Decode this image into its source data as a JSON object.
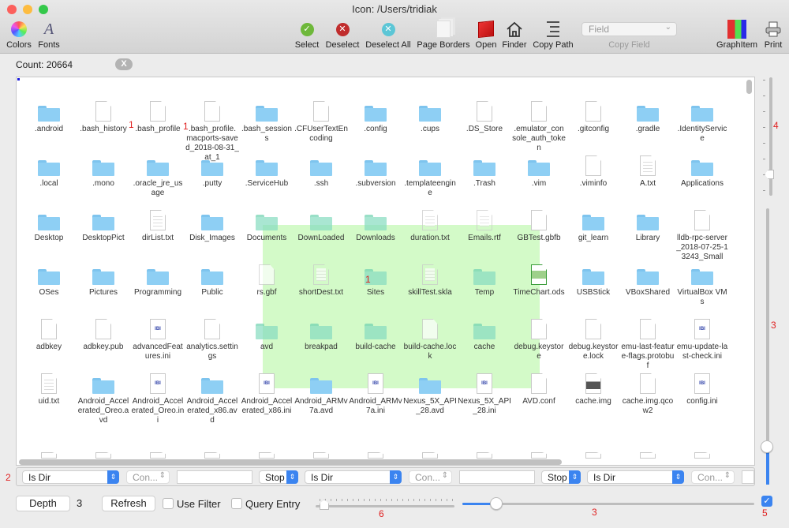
{
  "window": {
    "title": "Icon: /Users/tridiak"
  },
  "toolbar": {
    "colors": "Colors",
    "fonts": "Fonts",
    "select": "Select",
    "deselect": "Deselect",
    "deselect_all": "Deselect All",
    "page_borders": "Page Borders",
    "open": "Open",
    "finder": "Finder",
    "copy_path": "Copy Path",
    "field_placeholder": "Field",
    "copy_field": "Copy Field",
    "graph_item": "GraphItem",
    "print": "Print"
  },
  "status": {
    "count": "Count: 20664",
    "clear": "X"
  },
  "grid": {
    "selection_badge": "1",
    "badges": [
      "1",
      "1"
    ],
    "rows": [
      [
        {
          "name": ".android",
          "type": "folder"
        },
        {
          "name": ".bash_history",
          "type": "doc"
        },
        {
          "name": ".bash_profile",
          "type": "doc"
        },
        {
          "name": ".bash_profile.macports-saved_2018-08-31_at_1",
          "type": "doc"
        },
        {
          "name": ".bash_sessions",
          "type": "folder"
        },
        {
          "name": ".CFUserTextEncoding",
          "type": "doc"
        },
        {
          "name": ".config",
          "type": "folder"
        },
        {
          "name": ".cups",
          "type": "folder"
        },
        {
          "name": ".DS_Store",
          "type": "doc"
        },
        {
          "name": ".emulator_console_auth_token",
          "type": "doc"
        },
        {
          "name": ".gitconfig",
          "type": "doc"
        },
        {
          "name": ".gradle",
          "type": "folder"
        },
        {
          "name": ".IdentityService",
          "type": "folder"
        }
      ],
      [
        {
          "name": ".local",
          "type": "folder"
        },
        {
          "name": ".mono",
          "type": "folder"
        },
        {
          "name": ".oracle_jre_usage",
          "type": "folder"
        },
        {
          "name": ".putty",
          "type": "folder"
        },
        {
          "name": ".ServiceHub",
          "type": "folder"
        },
        {
          "name": ".ssh",
          "type": "folder"
        },
        {
          "name": ".subversion",
          "type": "folder"
        },
        {
          "name": ".templateengine",
          "type": "folder"
        },
        {
          "name": ".Trash",
          "type": "folder"
        },
        {
          "name": ".vim",
          "type": "folder"
        },
        {
          "name": ".viminfo",
          "type": "doc"
        },
        {
          "name": "A.txt",
          "type": "txt"
        },
        {
          "name": "Applications",
          "type": "folder"
        }
      ],
      [
        {
          "name": "Desktop",
          "type": "folder"
        },
        {
          "name": "DesktopPict",
          "type": "folder"
        },
        {
          "name": "dirList.txt",
          "type": "txt"
        },
        {
          "name": "Disk_Images",
          "type": "folder"
        },
        {
          "name": "Documents",
          "type": "folder",
          "selected": true
        },
        {
          "name": "DownLoaded",
          "type": "folder",
          "selected": true
        },
        {
          "name": "Downloads",
          "type": "folder",
          "selected": true
        },
        {
          "name": "duration.txt",
          "type": "txt",
          "selected": true
        },
        {
          "name": "Emails.rtf",
          "type": "txt",
          "selected": true
        },
        {
          "name": "GBTest.gbfb",
          "type": "doc"
        },
        {
          "name": "git_learn",
          "type": "folder"
        },
        {
          "name": "Library",
          "type": "folder"
        },
        {
          "name": "lldb-rpc-server_2018-07-25-13243_Small",
          "type": "doc"
        }
      ],
      [
        {
          "name": "OSes",
          "type": "folder"
        },
        {
          "name": "Pictures",
          "type": "folder"
        },
        {
          "name": "Programming",
          "type": "folder"
        },
        {
          "name": "Public",
          "type": "folder"
        },
        {
          "name": "rs.gbf",
          "type": "doc",
          "selected": true
        },
        {
          "name": "shortDest.txt",
          "type": "txt",
          "selected": true
        },
        {
          "name": "Sites",
          "type": "folder",
          "selected": true
        },
        {
          "name": "skillTest.skla",
          "type": "txt",
          "selected": true
        },
        {
          "name": "Temp",
          "type": "folder",
          "selected": true
        },
        {
          "name": "TimeChart.ods",
          "type": "ods"
        },
        {
          "name": "USBStick",
          "type": "folder"
        },
        {
          "name": "VBoxShared",
          "type": "folder"
        },
        {
          "name": "VirtualBox VMs",
          "type": "folder"
        }
      ],
      [
        {
          "name": "adbkey",
          "type": "doc"
        },
        {
          "name": "adbkey.pub",
          "type": "doc"
        },
        {
          "name": "advancedFeatures.ini",
          "type": "ini"
        },
        {
          "name": "analytics.settings",
          "type": "doc"
        },
        {
          "name": "avd",
          "type": "folder",
          "selected": true
        },
        {
          "name": "breakpad",
          "type": "folder",
          "selected": true
        },
        {
          "name": "build-cache",
          "type": "folder",
          "selected": true
        },
        {
          "name": "build-cache.lock",
          "type": "doc",
          "selected": true
        },
        {
          "name": "cache",
          "type": "folder",
          "selected": true
        },
        {
          "name": "debug.keystore",
          "type": "doc"
        },
        {
          "name": "debug.keystore.lock",
          "type": "doc"
        },
        {
          "name": "emu-last-feature-flags.protobuf",
          "type": "doc"
        },
        {
          "name": "emu-update-last-check.ini",
          "type": "ini"
        }
      ],
      [
        {
          "name": "uid.txt",
          "type": "txt"
        },
        {
          "name": "Android_Accelerated_Oreo.avd",
          "type": "folder"
        },
        {
          "name": "Android_Accelerated_Oreo.ini",
          "type": "ini"
        },
        {
          "name": "Android_Accelerated_x86.avd",
          "type": "folder"
        },
        {
          "name": "Android_Accelerated_x86.ini",
          "type": "ini"
        },
        {
          "name": "Android_ARMv7a.avd",
          "type": "folder"
        },
        {
          "name": "Android_ARMv7a.ini",
          "type": "ini"
        },
        {
          "name": "Nexus_5X_API_28.avd",
          "type": "folder"
        },
        {
          "name": "Nexus_5X_API_28.ini",
          "type": "ini"
        },
        {
          "name": "AVD.conf",
          "type": "doc"
        },
        {
          "name": "cache.img",
          "type": "img"
        },
        {
          "name": "cache.img.qcow2",
          "type": "doc"
        },
        {
          "name": "config.ini",
          "type": "ini"
        }
      ]
    ]
  },
  "filters": [
    {
      "field": "Is Dir",
      "op": "Con...",
      "value": "",
      "action": "Stop"
    },
    {
      "field": "Is Dir",
      "op": "Con...",
      "value": "",
      "action": "Stop"
    },
    {
      "field": "Is Dir",
      "op": "Con...",
      "value": ""
    }
  ],
  "bottom": {
    "depth_label": "Depth",
    "depth_value": "3",
    "refresh": "Refresh",
    "use_filter": "Use Filter",
    "query_entry": "Query Entry",
    "use_filter_checked": false,
    "query_entry_checked": false,
    "option_checked": true,
    "slider_small_value": 0,
    "slider_large_fraction": 0.1
  },
  "annotations": {
    "a2": "2",
    "a3h": "3",
    "a3v": "3",
    "a4": "4",
    "a5": "5",
    "a6": "6"
  },
  "colors": {
    "selection": "#d3fac8",
    "accent": "#3b84f0",
    "annotation": "#e02020"
  }
}
